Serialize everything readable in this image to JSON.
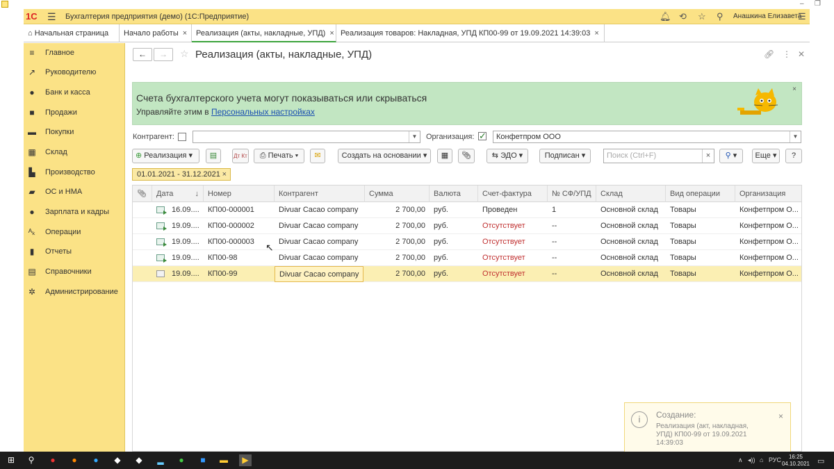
{
  "titlebar": {
    "logo": "1С",
    "app_title": "Бухгалтерия предприятия (демо)  (1С:Предприятие)",
    "user": "Анашкина Елизавета"
  },
  "tabs": [
    {
      "label": "Начальная страница",
      "close": ""
    },
    {
      "label": "Начало работы",
      "close": "×"
    },
    {
      "label": "Реализация (акты, накладные, УПД)",
      "close": "×"
    },
    {
      "label": "Реализация товаров: Накладная, УПД КП00-99 от 19.09.2021 14:39:03",
      "close": "×"
    }
  ],
  "sidebar": {
    "items": [
      {
        "label": "Главное",
        "icon": "≡"
      },
      {
        "label": "Руководителю",
        "icon": "↗"
      },
      {
        "label": "Банк и касса",
        "icon": "●"
      },
      {
        "label": "Продажи",
        "icon": "■"
      },
      {
        "label": "Покупки",
        "icon": "▬"
      },
      {
        "label": "Склад",
        "icon": "▦"
      },
      {
        "label": "Производство",
        "icon": "▙"
      },
      {
        "label": "ОС и НМА",
        "icon": "▰"
      },
      {
        "label": "Зарплата и кадры",
        "icon": "●"
      },
      {
        "label": "Операции",
        "icon": "ᴬₖ"
      },
      {
        "label": "Отчеты",
        "icon": "▮"
      },
      {
        "label": "Справочники",
        "icon": "▤"
      },
      {
        "label": "Администрирование",
        "icon": "✲"
      }
    ]
  },
  "page": {
    "title": "Реализация (акты, накладные, УПД)",
    "back": "←",
    "forward": "→",
    "star": "☆"
  },
  "banner": {
    "line1": "Счета бухгалтерского учета могут показываться или скрываться",
    "line2_prefix": "Управляйте этим в ",
    "line2_link": "Персональных настройках",
    "close": "×"
  },
  "filters": {
    "counterparty_label": "Контрагент:",
    "counterparty_value": "",
    "organization_label": "Организация:",
    "organization_value": "Конфетпром ООО"
  },
  "toolbar": {
    "realization": "Реализация",
    "print": "Печать",
    "create_based": "Создать на основании",
    "edo": "ЭДО",
    "signed": "Подписан",
    "search_placeholder": "Поиск (Ctrl+F)",
    "more": "Еще",
    "help": "?"
  },
  "period": {
    "label": "01.01.2021 - 31.12.2021",
    "close": "×"
  },
  "table": {
    "columns": [
      "Дата",
      "Номер",
      "Контрагент",
      "Сумма",
      "Валюта",
      "Счет-фактура",
      "№ СФ/УПД",
      "Склад",
      "Вид операции",
      "Организация"
    ],
    "rows": [
      {
        "date": "16.09....",
        "number": "КП00-000001",
        "counterparty": "Divuar Cacao company",
        "sum": "2 700,00",
        "currency": "руб.",
        "invoice": "Проведен",
        "sf": "1",
        "warehouse": "Основной склад",
        "op": "Товары",
        "org": "Конфетпром О..."
      },
      {
        "date": "19.09....",
        "number": "КП00-000002",
        "counterparty": "Divuar Cacao company",
        "sum": "2 700,00",
        "currency": "руб.",
        "invoice": "Отсутствует",
        "sf": "--",
        "warehouse": "Основной склад",
        "op": "Товары",
        "org": "Конфетпром О..."
      },
      {
        "date": "19.09....",
        "number": "КП00-000003",
        "counterparty": "Divuar Cacao company",
        "sum": "2 700,00",
        "currency": "руб.",
        "invoice": "Отсутствует",
        "sf": "--",
        "warehouse": "Основной склад",
        "op": "Товары",
        "org": "Конфетпром О..."
      },
      {
        "date": "19.09....",
        "number": "КП00-98",
        "counterparty": "Divuar Cacao company",
        "sum": "2 700,00",
        "currency": "руб.",
        "invoice": "Отсутствует",
        "sf": "--",
        "warehouse": "Основной склад",
        "op": "Товары",
        "org": "Конфетпром О..."
      },
      {
        "date": "19.09....",
        "number": "КП00-99",
        "counterparty": "Divuar Cacao company",
        "sum": "2 700,00",
        "currency": "руб.",
        "invoice": "Отсутствует",
        "sf": "--",
        "warehouse": "Основной склад",
        "op": "Товары",
        "org": "Конфетпром О..."
      }
    ]
  },
  "notification": {
    "title": "Создание:",
    "body": "Реализация (акт, накладная, УПД) КП00-99 от 19.09.2021 14:39:03",
    "close": "×"
  },
  "taskbar": {
    "lang": "РУС",
    "time": "16:25",
    "date": "04.10.2021"
  },
  "colors": {
    "accent_yellow": "#fbe286",
    "banner_green": "#c2e6c2",
    "status_red": "#c03030",
    "link_blue": "#1a4fb0"
  }
}
